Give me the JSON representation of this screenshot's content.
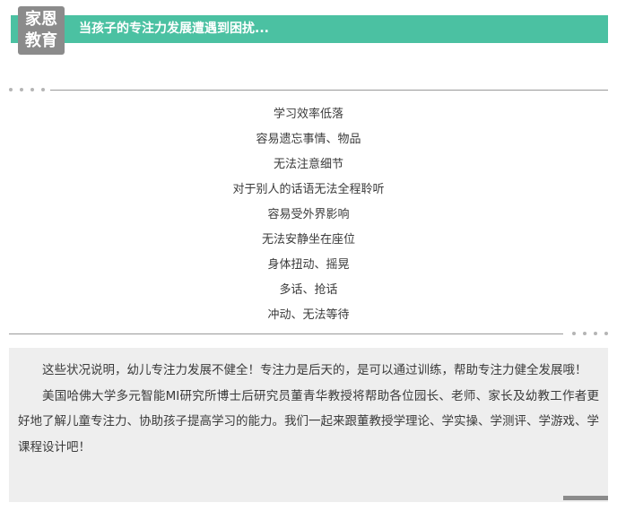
{
  "header": {
    "logo_line1": "家恩",
    "logo_line2": "教育",
    "title": "当孩子的专注力发展遭遇到困扰...",
    "accent_color": "#4bc1a2",
    "logo_color": "#8b8b8b"
  },
  "symptoms": [
    "学习效率低落",
    "容易遗忘事情、物品",
    "无法注意细节",
    "对于别人的话语无法全程聆听",
    "容易受外界影响",
    "无法安静坐在座位",
    "身体扭动、摇晃",
    "多话、抢话",
    "冲动、无法等待"
  ],
  "info": {
    "paragraph1": "这些状况说明，幼儿专注力发展不健全！专注力是后天的，是可以通过训练，帮助专注力健全发展哦！",
    "paragraph2": "美国哈佛大学多元智能MI研究所博士后研究员董青华教授将帮助各位园长、老师、家长及幼教工作者更好地了解儿童专注力、协助孩子提高学习的能力。我们一起来跟董教授学理论、学实操、学测评、学游戏、学课程设计吧！",
    "background_color": "#eeeeee"
  }
}
